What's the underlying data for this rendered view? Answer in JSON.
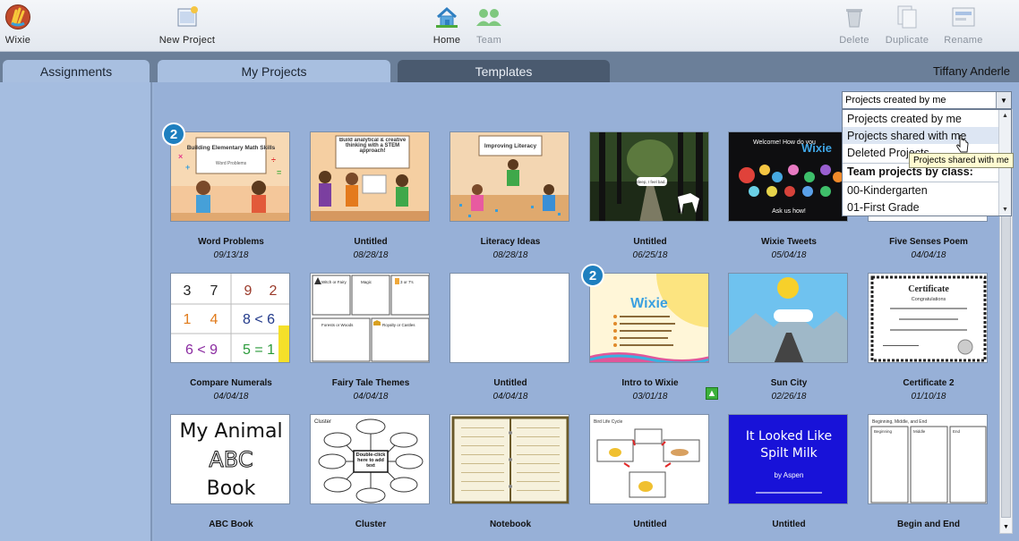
{
  "toolbar": {
    "wixie": "Wixie",
    "new_project": "New Project",
    "home": "Home",
    "team": "Team",
    "delete": "Delete",
    "duplicate": "Duplicate",
    "rename": "Rename"
  },
  "tabs": {
    "assignments": "Assignments",
    "my_projects": "My Projects",
    "templates": "Templates"
  },
  "user_name": "Tiffany Anderle",
  "filter": {
    "selected": "Projects created by me",
    "options": [
      "Projects created by me",
      "Projects shared with me",
      "Deleted Projects",
      "Team projects by class:",
      "00-Kindergarten",
      "01-First Grade"
    ],
    "tooltip": "Projects shared with me"
  },
  "projects": [
    {
      "title": "Word Problems",
      "date": "09/13/18",
      "badge": "2",
      "thumb_text": "Building Elementary Math Skills",
      "thumb_sub": "Word Problems"
    },
    {
      "title": "Untitled",
      "date": "08/28/18",
      "thumb_text": "Build analytical & creative thinking with a STEM approach!"
    },
    {
      "title": "Literacy Ideas",
      "date": "08/28/18",
      "thumb_text": "Improving Literacy"
    },
    {
      "title": "Untitled",
      "date": "06/25/18",
      "thumb_text": "Sleep, I feel bad..."
    },
    {
      "title": "Wixie Tweets",
      "date": "05/04/18",
      "thumb_text": "Welcome! How do you",
      "thumb_brand": "Wixie",
      "thumb_sub": "Ask us how!"
    },
    {
      "title": "Five Senses Poem",
      "date": "04/04/18"
    },
    {
      "title": "Compare Numerals",
      "date": "04/04/18"
    },
    {
      "title": "Fairy Tale Themes",
      "date": "04/04/18",
      "thumb_cells": [
        "Witch or Fairy",
        "Magic",
        "3 or 7's",
        "Forests or Woods",
        "Royalty or Castles"
      ]
    },
    {
      "title": "Untitled",
      "date": "04/04/18"
    },
    {
      "title": "Intro to Wixie",
      "date": "03/01/18",
      "badge": "2",
      "thumb_brand": "Wixie"
    },
    {
      "title": "Sun City",
      "date": "02/26/18"
    },
    {
      "title": "Certificate 2",
      "date": "01/10/18",
      "thumb_text": "Certificate",
      "thumb_sub": "Congratulations"
    },
    {
      "title": "ABC Book",
      "date": "",
      "thumb_lines": [
        "My Animal",
        "ABC",
        "Book"
      ]
    },
    {
      "title": "Cluster",
      "date": "",
      "thumb_text": "Cluster",
      "thumb_sub": "Double-click here to add text"
    },
    {
      "title": "Notebook",
      "date": ""
    },
    {
      "title": "Untitled",
      "date": "",
      "thumb_text": "Bird Life Cycle"
    },
    {
      "title": "Untitled",
      "date": "",
      "thumb_lines": [
        "It Looked Like",
        "Spilt Milk",
        "by Aspen"
      ]
    },
    {
      "title": "Begin and End",
      "date": "",
      "thumb_text": "Beginning, Middle, and End",
      "thumb_cells": [
        "Beginning",
        "Middle",
        "End"
      ]
    }
  ],
  "colors": {
    "main_bg": "#97b0d7",
    "tab_bar": "#6b7f99",
    "badge": "#1e7fbf"
  }
}
